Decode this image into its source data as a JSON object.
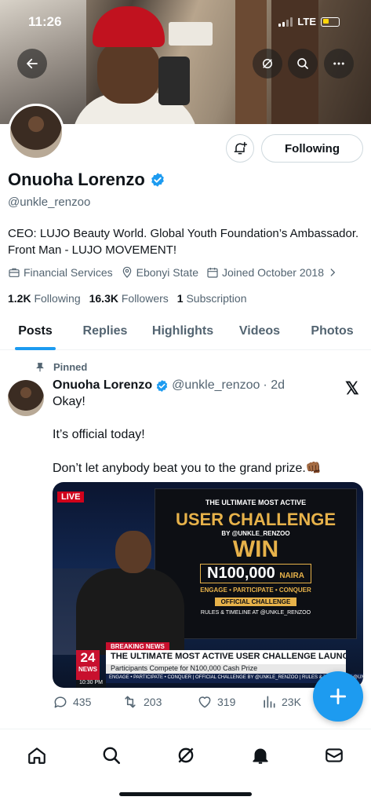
{
  "status": {
    "time": "11:26",
    "network": "LTE"
  },
  "profile": {
    "name": "Onuoha Lorenzo",
    "handle": "@unkle_renzoo",
    "follow_label": "Following",
    "bio": "CEO: LUJO Beauty World. Global Youth Foundation’s Ambassador. Front Man - LUJO MOVEMENT!",
    "category": "Financial Services",
    "location": "Ebonyi State",
    "joined": "Joined October 2018",
    "following_count": "1.2K",
    "following_label": "Following",
    "followers_count": "16.3K",
    "followers_label": "Followers",
    "subscription_count": "1",
    "subscription_label": "Subscription"
  },
  "tabs": [
    {
      "label": "Posts",
      "active": true
    },
    {
      "label": "Replies"
    },
    {
      "label": "Highlights"
    },
    {
      "label": "Videos"
    },
    {
      "label": "Photos"
    }
  ],
  "tweet": {
    "pinned_label": "Pinned",
    "author": "Onuoha Lorenzo",
    "handle": "@unkle_renzoo",
    "time": "· 2d",
    "lines": [
      "Okay!",
      "It’s official today!",
      "Don’t let anybody beat you to the grand prize.👊🏾"
    ],
    "media": {
      "live": "LIVE",
      "poster_l1": "THE ULTIMATE MOST ACTIVE",
      "poster_l2": "USER CHALLENGE",
      "poster_l3": "BY @UNKLE_RENZOO",
      "poster_l4": "WIN",
      "poster_amount": "N100,000",
      "poster_currency": "NAIRA",
      "poster_l6": "ENGAGE • PARTICIPATE • CONQUER",
      "poster_l7": "OFFICIAL CHALLENGE",
      "poster_l8": "RULES & TIMELINE AT @UNKLE_RENZOO",
      "breaking": "BREAKING NEWS",
      "channel_num": "24",
      "channel_name": "NEWS",
      "headline": "THE ULTIMATE MOST ACTIVE USER CHALLENGE LAUNCHED",
      "subhead": "Participants Compete for N100,000 Cash Prize",
      "clock": "10:30 PM",
      "crawl": "ENGAGE • PARTICIPATE • CONQUER | OFFICIAL CHALLENGE BY @UNKLE_RENZOO | RULES & TIMELINE AT @UNKLE_RENZOO"
    },
    "replies": "435",
    "reposts": "203",
    "likes": "319",
    "views": "23K"
  },
  "colors": {
    "accent": "#1d9bf0",
    "text": "#0f1419",
    "muted": "#536471"
  }
}
